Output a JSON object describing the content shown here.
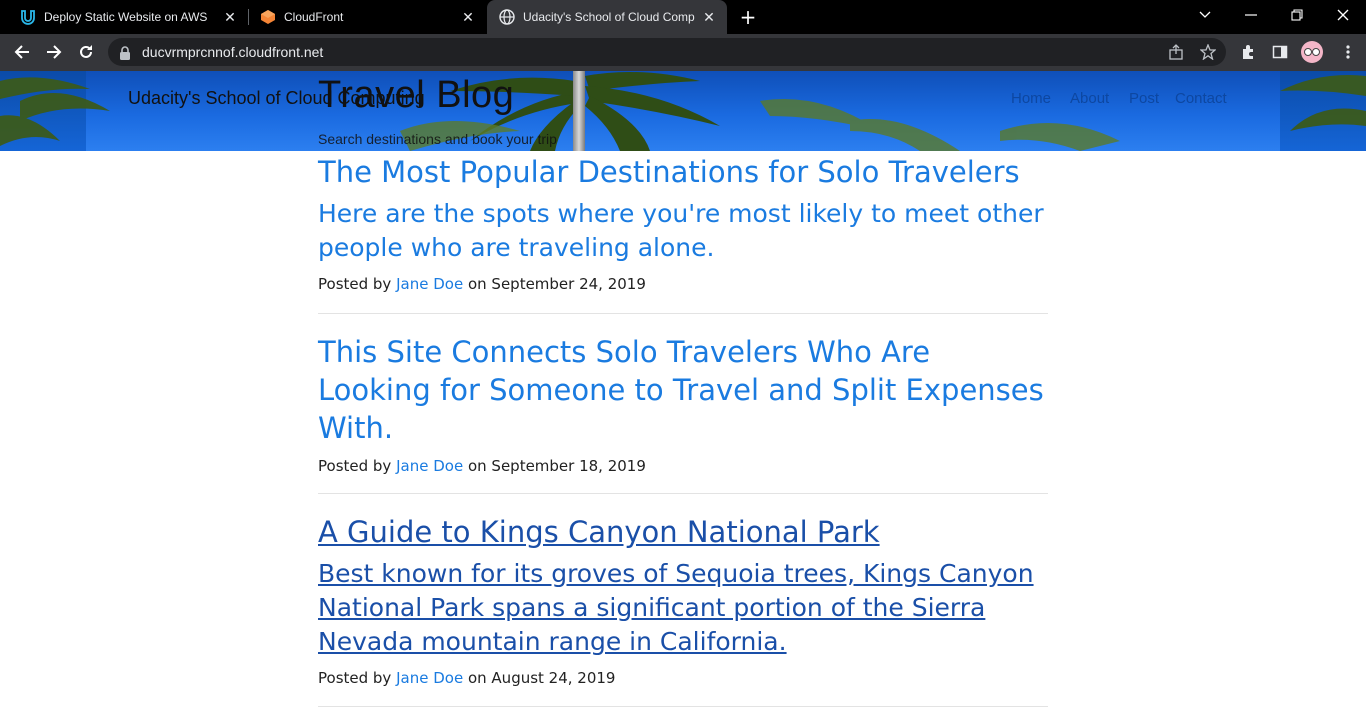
{
  "browser": {
    "tabs": [
      {
        "title": "Deploy Static Website on AWS",
        "icon": "udacity-icon",
        "active": false
      },
      {
        "title": "CloudFront",
        "icon": "aws-cloudfront-icon",
        "active": false
      },
      {
        "title": "Udacity's School of Cloud Compu",
        "icon": "globe-icon",
        "active": true
      }
    ],
    "url": "ducvrmprcnnof.cloudfront.net"
  },
  "site": {
    "brand": "Udacity's School of Cloud Computing",
    "title": "Travel Blog",
    "subtitle": "Search destinations and book your trip",
    "nav": [
      "Home",
      "About",
      "Post",
      "Contact"
    ]
  },
  "posts": [
    {
      "title": "The Most Popular Destinations for Solo Travelers",
      "subtitle": "Here are the spots where you're most likely to meet other people who are traveling alone.",
      "posted_by": "Posted by",
      "author": "Jane Doe",
      "on": "on",
      "date": "September 24, 2019"
    },
    {
      "title": "This Site Connects Solo Travelers Who Are Looking for Someone to Travel and Split Expenses With.",
      "subtitle": "",
      "posted_by": "Posted by",
      "author": "Jane Doe",
      "on": "on",
      "date": "September 18, 2019"
    },
    {
      "title": "A Guide to Kings Canyon National Park",
      "subtitle": "Best known for its groves of Sequoia trees, Kings Canyon National Park spans a significant portion of the Sierra Nevada mountain range in California.",
      "posted_by": "Posted by",
      "author": "Jane Doe",
      "on": "on",
      "date": "August 24, 2019"
    }
  ]
}
